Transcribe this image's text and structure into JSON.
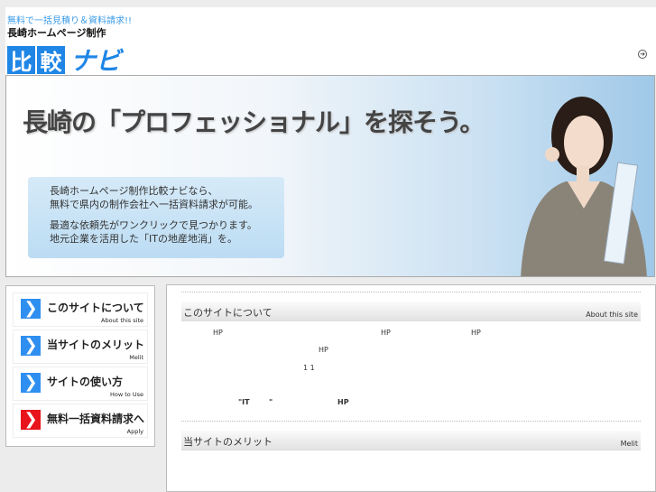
{
  "header": {
    "tagline": "無料で一括見積り＆資料請求!!",
    "subtitle": "長崎ホームページ制作",
    "logo_chars": [
      "比",
      "較"
    ],
    "logo_rest": "ナビ"
  },
  "hero": {
    "headline": "長崎の「プロフェッショナル」を探そう。",
    "lines": [
      "長崎ホームページ制作比較ナビなら、",
      "無料で県内の制作会社へ一括資料請求が可能。",
      "",
      "最適な依頼先がワンクリックで見つかります。",
      "地元企業を活用した「ITの地産地消」を。"
    ]
  },
  "sidebar": [
    {
      "label": "このサイトについて",
      "en": "About this site"
    },
    {
      "label": "当サイトのメリット",
      "en": "Melit"
    },
    {
      "label": "サイトの使い方",
      "en": "How to Use"
    },
    {
      "label": "無料一括資料請求へ",
      "en": "Apply"
    }
  ],
  "main": {
    "sections": [
      {
        "title": "このサイトについて",
        "en": "About this site",
        "fragments": [
          "HP",
          "HP",
          "HP",
          "HP",
          "1 1",
          "\"IT",
          "\"",
          "HP"
        ]
      },
      {
        "title": "当サイトのメリット",
        "en": "Melit"
      }
    ]
  },
  "colors": {
    "brand": "#1f86e6",
    "apply": "#e8131b"
  }
}
